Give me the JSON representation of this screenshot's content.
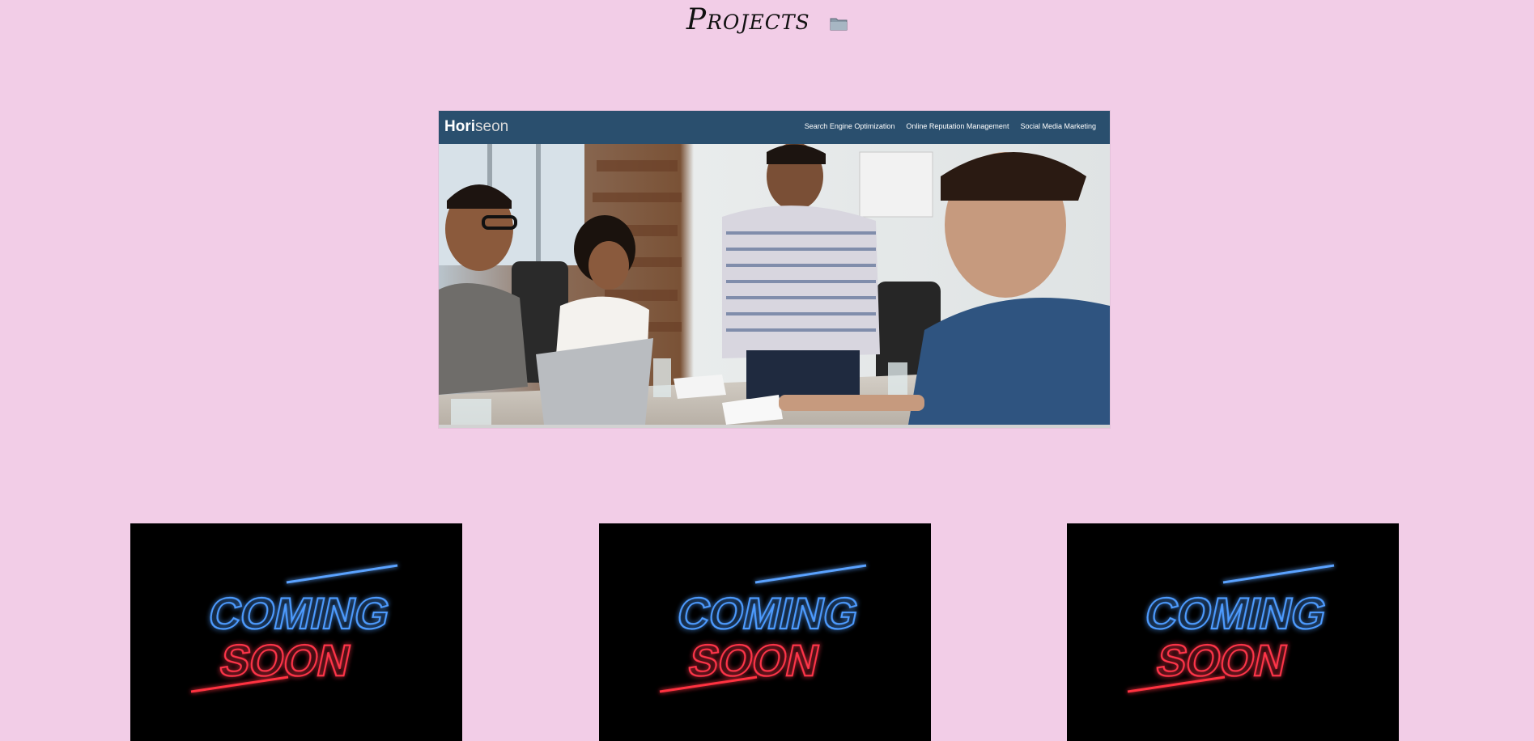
{
  "heading": {
    "title": "Projects",
    "icon": "folder-icon"
  },
  "featured_project": {
    "logo_main": "Hori",
    "logo_accent": "seon",
    "nav": [
      "Search Engine Optimization",
      "Online Reputation Management",
      "Social Media Marketing"
    ],
    "header_color": "#2a4f6e"
  },
  "placeholders": [
    {
      "line1": "COMING",
      "line2": "SOON"
    },
    {
      "line1": "COMING",
      "line2": "SOON"
    },
    {
      "line1": "COMING",
      "line2": "SOON"
    }
  ],
  "colors": {
    "background": "#f2cde7",
    "neon_blue": "#3a8bff",
    "neon_red": "#ff2a3a"
  }
}
